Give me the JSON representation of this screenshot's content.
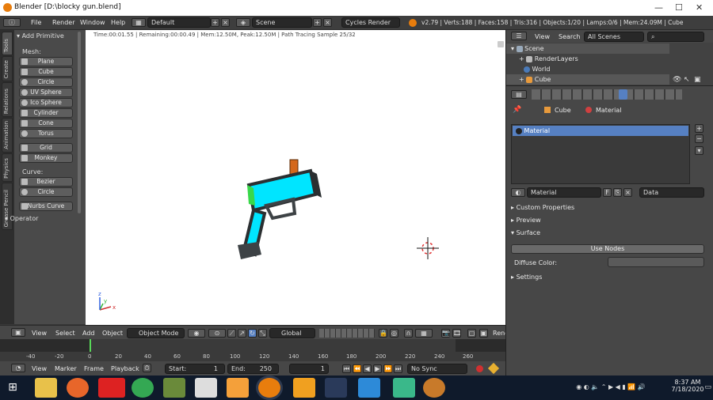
{
  "window": {
    "title": "Blender [D:\\blocky gun.blend]",
    "controls": [
      "—",
      "☐",
      "✕"
    ]
  },
  "menubar": {
    "menus": [
      "File",
      "Render",
      "Window",
      "Help"
    ],
    "layout": "Default",
    "scene": "Scene",
    "engine": "Cycles Render",
    "stats": "v2.79 | Verts:188 | Faces:158 | Tris:316 | Objects:1/20 | Lamps:0/6 | Mem:24.09M | Cube"
  },
  "toolshelf": {
    "tabs": [
      "Tools",
      "Create",
      "Relations",
      "Animation",
      "Physics",
      "Grease Pencil"
    ],
    "panel_title": "Add Primitive",
    "mesh_label": "Mesh:",
    "mesh_items": [
      "Plane",
      "Cube",
      "Circle",
      "UV Sphere",
      "Ico Sphere",
      "Cylinder",
      "Cone",
      "Torus",
      "Grid",
      "Monkey"
    ],
    "curve_label": "Curve:",
    "curve_items": [
      "Bezier",
      "Circle",
      "Nurbs Curve"
    ],
    "operator": "Operator"
  },
  "viewport": {
    "info": "Time:00:01.55 | Remaining:00:00.49 | Mem:12.50M, Peak:12.50M | Path Tracing Sample 25/32",
    "axis_x": "x",
    "axis_y": "y",
    "axis_z": "z"
  },
  "viewheader": {
    "menus": [
      "View",
      "Select",
      "Add",
      "Object"
    ],
    "mode": "Object Mode",
    "orientation": "Global",
    "render": "Rend"
  },
  "timeline": {
    "ticks": [
      "-40",
      "-20",
      "0",
      "20",
      "40",
      "60",
      "80",
      "100",
      "120",
      "140",
      "160",
      "180",
      "200",
      "220",
      "240",
      "260"
    ],
    "menus": [
      "View",
      "Marker",
      "Frame",
      "Playback"
    ],
    "start_label": "Start:",
    "start": "1",
    "end_label": "End:",
    "end": "250",
    "current": "1",
    "sync": "No Sync"
  },
  "outliner": {
    "menus": [
      "View",
      "Search"
    ],
    "filter": "All Scenes",
    "items": [
      "Scene",
      "RenderLayers",
      "World",
      "Cube"
    ]
  },
  "properties": {
    "breadcrumb": [
      "Cube",
      "Material"
    ],
    "slot": "Material",
    "material_name": "Material",
    "fake_user": "F",
    "link": "Data",
    "panels": [
      "Custom Properties",
      "Preview",
      "Surface",
      "Settings"
    ],
    "use_nodes": "Use Nodes",
    "diffuse_label": "Diffuse Color:"
  },
  "taskbar": {
    "time": "8:37 AM",
    "date": "7/18/2020"
  },
  "colors": {
    "accent": "#5680c2",
    "gun_cyan": "#00e5ff",
    "gun_dark": "#3d4245"
  }
}
